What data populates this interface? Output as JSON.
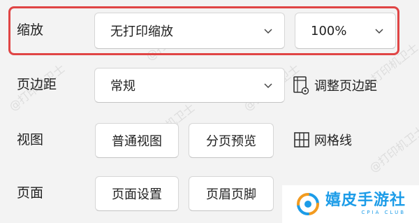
{
  "rows": {
    "scale": {
      "label": "缩放",
      "scale_select_value": "无打印缩放",
      "zoom_select_value": "100%"
    },
    "margins": {
      "label": "页边距",
      "margins_select_value": "常规",
      "adjust_label": "调整页边距"
    },
    "view": {
      "label": "视图",
      "normal_view": "普通视图",
      "page_break_preview": "分页预览",
      "gridlines_label": "网格线"
    },
    "page": {
      "label": "页面",
      "page_setup": "页面设置",
      "header_footer": "页眉页脚"
    }
  },
  "watermark": {
    "text": "@打印机卫士"
  },
  "logo": {
    "title": "嬉皮手游社",
    "subtitle": "CPIA CLUB"
  },
  "colors": {
    "highlight": "#e04545",
    "logo_blue": "#1c9ce8",
    "logo_orange": "#f29b20"
  }
}
